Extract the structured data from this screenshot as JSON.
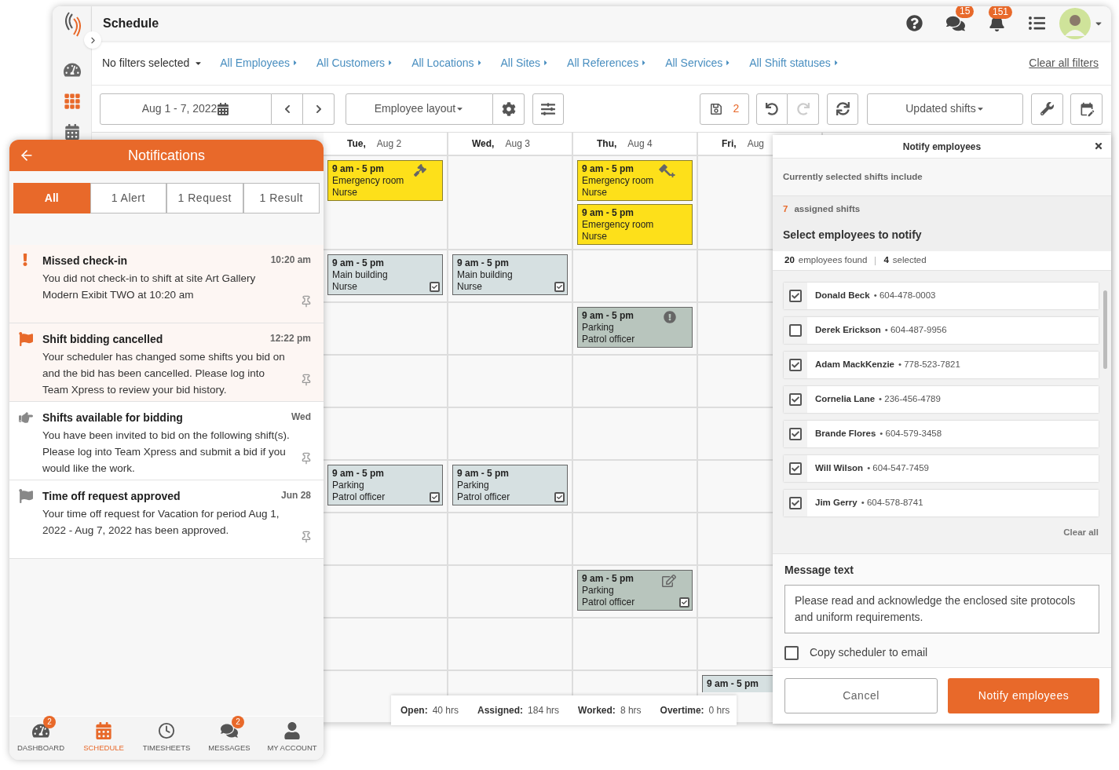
{
  "header": {
    "title": "Schedule",
    "messages_badge": "15",
    "alerts_badge": "151"
  },
  "filters": {
    "summary": "No filters selected",
    "links": [
      "All Employees",
      "All Customers",
      "All Locations",
      "All Sites",
      "All References",
      "All Services",
      "All Shift statuses"
    ],
    "clear": "Clear all filters"
  },
  "toolbar": {
    "date_range": "Aug 1 - 7, 2022",
    "layout": "Employee layout",
    "unsaved_count": "2",
    "view": "Updated shifts"
  },
  "days": [
    {
      "day": "Tue,",
      "date": "Aug 2"
    },
    {
      "day": "Wed,",
      "date": "Aug 3"
    },
    {
      "day": "Thu,",
      "date": "Aug 4"
    },
    {
      "day": "Fri,",
      "date": "Aug"
    }
  ],
  "rows": [
    [
      [
        {
          "time": "9 am - 5 pm",
          "site": "Emergency room",
          "role": "Nurse",
          "kind": "open-bid"
        }
      ],
      [],
      [
        {
          "time": "9 am - 5 pm",
          "site": "Emergency room",
          "role": "Nurse",
          "kind": "open-bid-add"
        },
        {
          "time": "9 am - 5 pm",
          "site": "Emergency room",
          "role": "Nurse",
          "kind": "open"
        }
      ],
      []
    ],
    [
      [
        {
          "time": "9 am - 5 pm",
          "site": "Main building",
          "role": "Nurse",
          "kind": "assigned",
          "checked": true
        }
      ],
      [
        {
          "time": "9 am - 5 pm",
          "site": "Main building",
          "role": "Nurse",
          "kind": "assigned",
          "checked": true
        }
      ],
      [],
      []
    ],
    [
      [],
      [],
      [
        {
          "time": "9 am - 5 pm",
          "site": "Parking",
          "role": "Patrol officer",
          "kind": "changed-alert"
        }
      ],
      []
    ],
    [
      [],
      [],
      [],
      []
    ],
    [
      [],
      [],
      [],
      []
    ],
    [
      [
        {
          "time": "9 am - 5 pm",
          "site": "Parking",
          "role": "Patrol officer",
          "kind": "assigned",
          "checked": true
        }
      ],
      [
        {
          "time": "9 am - 5 pm",
          "site": "Parking",
          "role": "Patrol officer",
          "kind": "assigned",
          "checked": true
        }
      ],
      [],
      []
    ],
    [
      [],
      [],
      [],
      []
    ],
    [
      [],
      [],
      [
        {
          "time": "9 am - 5 pm",
          "site": "Parking",
          "role": "Patrol officer",
          "kind": "changed-edit",
          "checked": true
        }
      ],
      []
    ],
    [
      [],
      [],
      [],
      []
    ],
    [
      [],
      [],
      [],
      [
        {
          "time": "9 am - 5 pm",
          "kind": "assigned"
        }
      ]
    ]
  ],
  "stats": [
    {
      "label": "Open:",
      "value": "40 hrs"
    },
    {
      "label": "Assigned:",
      "value": "184 hrs"
    },
    {
      "label": "Worked:",
      "value": "8 hrs"
    },
    {
      "label": "Overtime:",
      "value": "0 hrs"
    }
  ],
  "notifications": {
    "title": "Notifications",
    "tabs": [
      {
        "label": "All",
        "selected": true
      },
      {
        "label": "1 Alert",
        "selected": false
      },
      {
        "label": "1 Request",
        "selected": false
      },
      {
        "label": "1 Result",
        "selected": false
      }
    ],
    "items": [
      {
        "kind": "alert",
        "unread": true,
        "title": "Missed check-in",
        "time": "10:20 am",
        "body": "You did not check-in to shift at site Art Gallery Modern Exibit TWO at 10:20 am"
      },
      {
        "kind": "cancelled",
        "unread": true,
        "title": "Shift bidding cancelled",
        "time": "12:22 pm",
        "body": "Your scheduler has changed some shifts you bid on and the bid has been cancelled. Please log into Team Xpress to review your bid history."
      },
      {
        "kind": "bidding",
        "unread": false,
        "title": "Shifts available for bidding",
        "time": "Wed",
        "body": "You have been invited to bid on the following shift(s). Please log into Team Xpress and submit a bid if you would like the work."
      },
      {
        "kind": "approved",
        "unread": false,
        "title": "Time off request approved",
        "time": "Jun 28",
        "body": "Your time off request for Vacation for period Aug 1, 2022 - Aug 7, 2022 has been approved."
      }
    ],
    "nav": [
      {
        "kind": "dashboard",
        "label": "DASHBOARD",
        "badge": "2",
        "selected": false
      },
      {
        "kind": "schedule",
        "label": "SCHEDULE",
        "selected": true
      },
      {
        "kind": "timesheets",
        "label": "TIMESHEETS",
        "selected": false
      },
      {
        "kind": "messages",
        "label": "MESSAGES",
        "badge": "2",
        "selected": false
      },
      {
        "kind": "account",
        "label": "MY ACCOUNT",
        "selected": false
      }
    ]
  },
  "notify": {
    "title": "Notify employees",
    "intro": "Currently selected shifts include",
    "assigned_count": "7",
    "assigned_label": "assigned shifts",
    "heading": "Select employees to notify",
    "found_count": "20",
    "found_label": "employees found",
    "selected_count": "4",
    "selected_label": "selected",
    "employees": [
      {
        "name": "Donald Beck",
        "phone": "• 604-478-0003",
        "checked": true
      },
      {
        "name": "Derek Erickson",
        "phone": "• 604-487-9956",
        "checked": false
      },
      {
        "name": "Adam MackKenzie",
        "phone": "• 778-523-7821",
        "checked": true
      },
      {
        "name": "Cornelia Lane",
        "phone": "• 236-456-4789",
        "checked": true
      },
      {
        "name": "Brande Flores",
        "phone": "• 604-579-3458",
        "checked": true
      },
      {
        "name": "Will Wilson",
        "phone": "• 604-547-7459",
        "checked": true
      },
      {
        "name": "Jim Gerry",
        "phone": "• 604-578-8741",
        "checked": true
      }
    ],
    "clear_all": "Clear all",
    "message_label": "Message text",
    "message": "Please read and acknowledge the enclosed site protocols and uniform requirements.",
    "copy_label": "Copy scheduler to email",
    "copy_checked": false,
    "cancel": "Cancel",
    "submit": "Notify employees"
  }
}
